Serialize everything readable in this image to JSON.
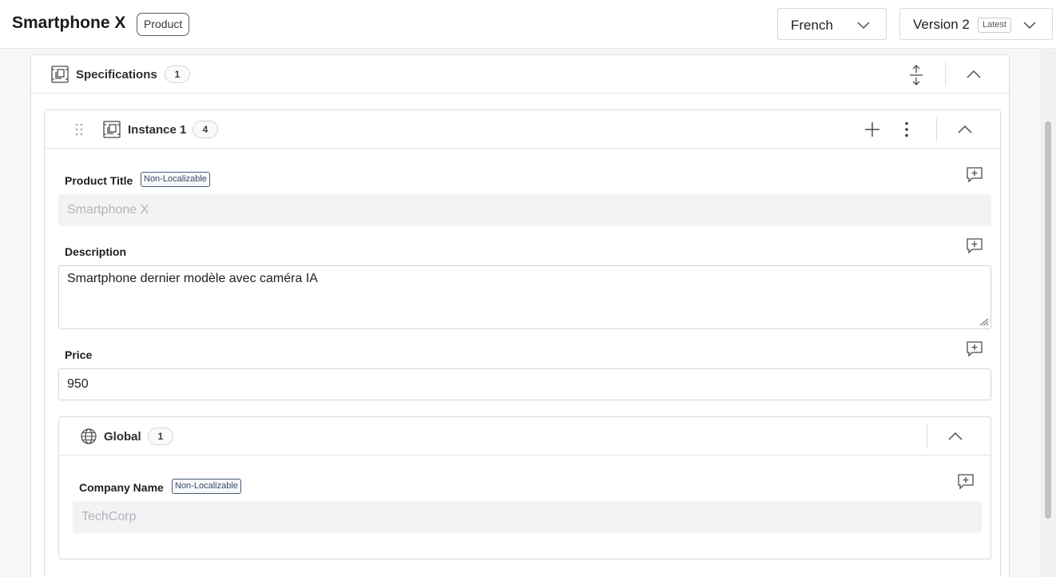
{
  "header": {
    "title": "Smartphone X",
    "type_badge": "Product",
    "language": {
      "selected": "French"
    },
    "version": {
      "selected": "Version 2",
      "tag": "Latest"
    }
  },
  "specifications": {
    "label": "Specifications",
    "count": "1",
    "instance": {
      "label": "Instance 1",
      "count": "4",
      "fields": {
        "product_title": {
          "label": "Product Title",
          "tag": "Non-Localizable",
          "value": "Smartphone X"
        },
        "description": {
          "label": "Description",
          "value": "Smartphone dernier modèle avec caméra IA"
        },
        "price": {
          "label": "Price",
          "value": "950"
        }
      },
      "global": {
        "label": "Global",
        "count": "1",
        "company_name": {
          "label": "Company Name",
          "tag": "Non-Localizable",
          "value": "TechCorp"
        }
      }
    }
  },
  "icons": [
    "component-icon",
    "expand-collapse-icon",
    "chevron-up-icon",
    "drag-handle-icon",
    "plus-icon",
    "more-vertical-icon",
    "comment-add-icon",
    "globe-icon",
    "chevron-down-icon"
  ]
}
